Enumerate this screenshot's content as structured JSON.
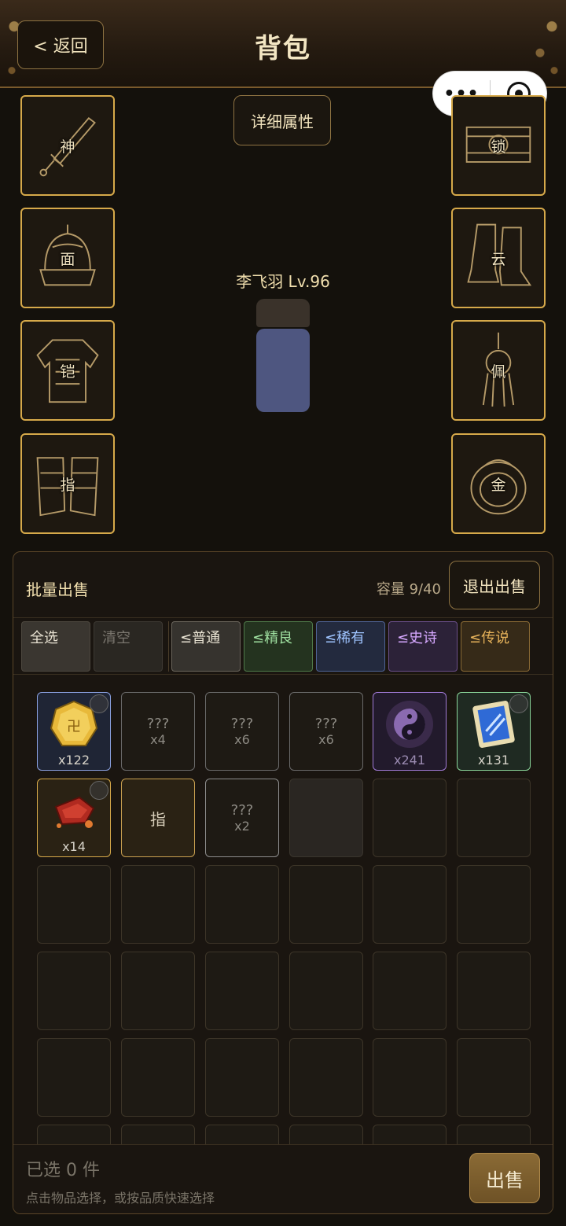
{
  "header": {
    "back_label": "< 返回",
    "title": "背包"
  },
  "detail_button": "详细属性",
  "character": {
    "name_level": "李飞羽 Lv.96"
  },
  "slots_left": [
    {
      "label": "神",
      "icon": "sword-icon"
    },
    {
      "label": "面",
      "icon": "helmet-icon"
    },
    {
      "label": "铠",
      "icon": "armor-icon"
    },
    {
      "label": "指",
      "icon": "gauntlet-icon"
    }
  ],
  "slots_right": [
    {
      "label": "锁",
      "icon": "belt-icon"
    },
    {
      "label": "云",
      "icon": "boots-icon"
    },
    {
      "label": "佩",
      "icon": "pendant-icon"
    },
    {
      "label": "金",
      "icon": "ring-icon"
    }
  ],
  "panel": {
    "title": "批量出售",
    "capacity": "容量 9/40",
    "exit_label": "退出出售"
  },
  "filters": [
    {
      "label": "全选",
      "color": "#e8e2d2"
    },
    {
      "label": "清空",
      "color": "#7a766e"
    },
    {
      "label": "≤普通",
      "color": "#e8e2d2"
    },
    {
      "label": "≤精良",
      "color": "#9fe0a0"
    },
    {
      "label": "≤稀有",
      "color": "#9fc4ff"
    },
    {
      "label": "≤史诗",
      "color": "#d6a8ff"
    },
    {
      "label": "≤传说",
      "color": "#e6b25a"
    }
  ],
  "items": [
    {
      "kind": "gold-coin-icon",
      "count": "x122",
      "border": "#8aa0e0"
    },
    {
      "kind": "unknown",
      "qm": "???",
      "count": "x4"
    },
    {
      "kind": "unknown",
      "qm": "???",
      "count": "x6"
    },
    {
      "kind": "unknown",
      "qm": "???",
      "count": "x6"
    },
    {
      "kind": "yin-yang-icon",
      "count": "x241",
      "border": "#a07ad6"
    },
    {
      "kind": "scroll-icon",
      "count": "x131",
      "border": "#8ad69a"
    },
    {
      "kind": "ore-icon",
      "count": "x14",
      "border": "#d6a94a"
    },
    {
      "kind": "text",
      "qm": "指",
      "border": "#c9a050"
    },
    {
      "kind": "unknown",
      "qm": "???",
      "count": "x2",
      "border": "#8d8d8d"
    }
  ],
  "footer": {
    "selected": "已选 0 件",
    "hint": "点击物品选择，或按品质快速选择",
    "sell_label": "出售"
  }
}
